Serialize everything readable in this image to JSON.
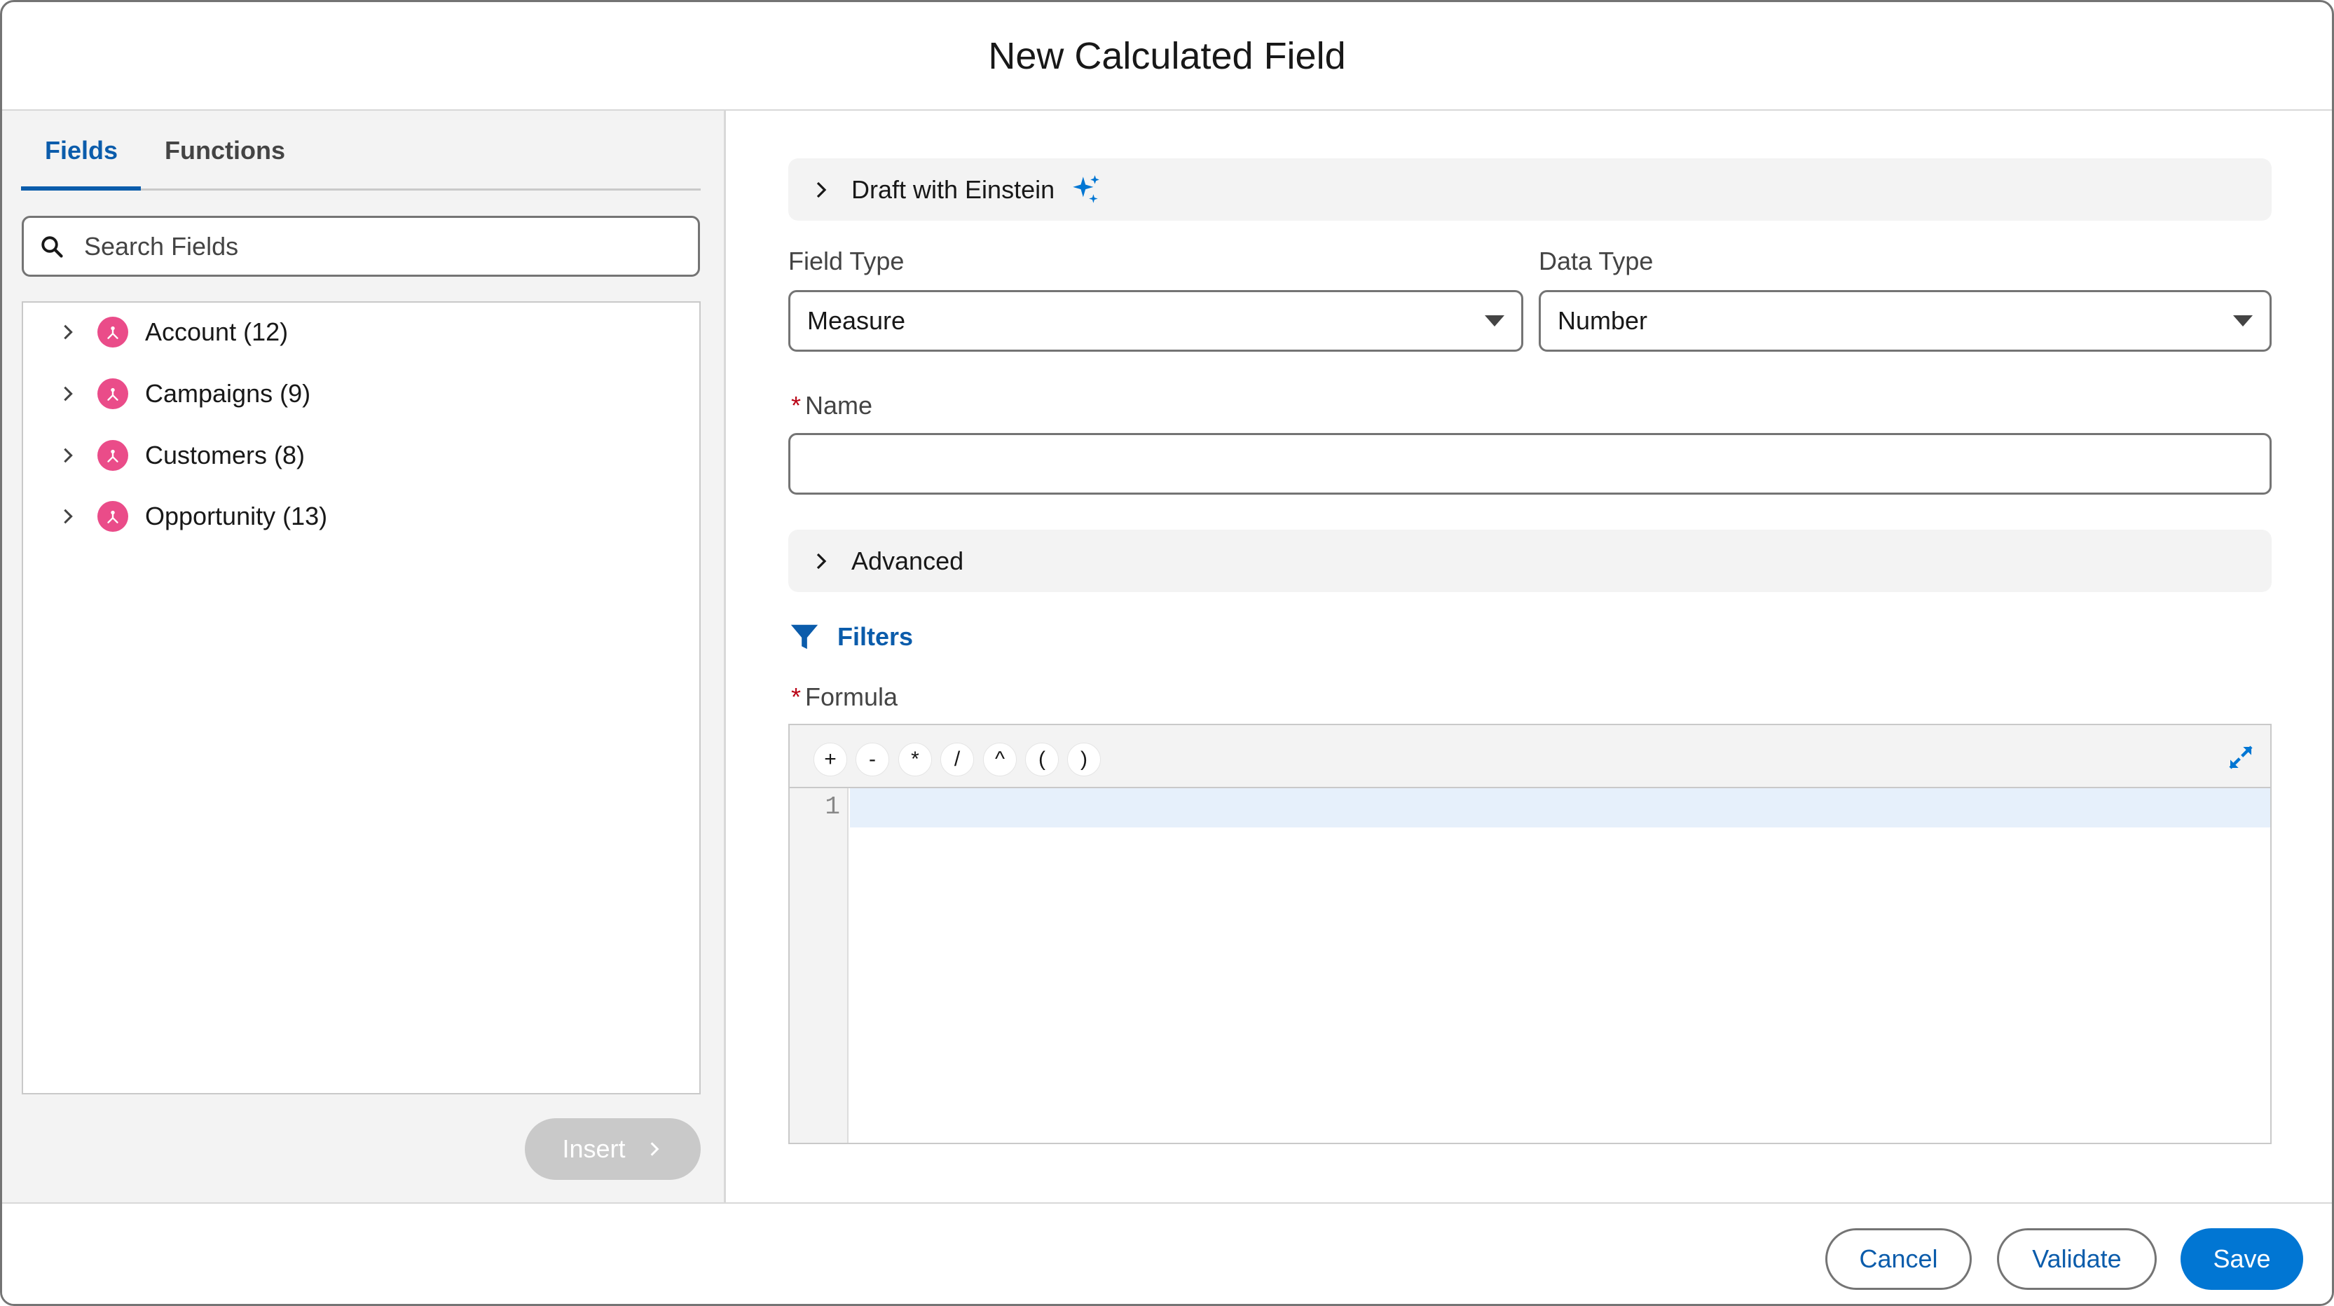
{
  "modal": {
    "title": "New Calculated Field"
  },
  "left_panel": {
    "tabs": [
      {
        "label": "Fields",
        "active": true
      },
      {
        "label": "Functions",
        "active": false
      }
    ],
    "search": {
      "placeholder": "Search Fields",
      "value": ""
    },
    "tree_items": [
      {
        "label": "Account (12)",
        "icon": "object-icon"
      },
      {
        "label": "Campaigns (9)",
        "icon": "object-icon"
      },
      {
        "label": "Customers (8)",
        "icon": "object-icon"
      },
      {
        "label": "Opportunity (13)",
        "icon": "object-icon"
      }
    ],
    "insert_label": "Insert"
  },
  "right_panel": {
    "einstein": {
      "label": "Draft with Einstein",
      "icon": "sparkles-icon"
    },
    "field_type": {
      "label": "Field Type",
      "value": "Measure"
    },
    "data_type": {
      "label": "Data Type",
      "value": "Number"
    },
    "name": {
      "label": "Name",
      "required_mark": "*",
      "value": ""
    },
    "advanced": {
      "label": "Advanced"
    },
    "filters": {
      "label": "Filters",
      "icon": "filter-icon"
    },
    "formula": {
      "label": "Formula",
      "required_mark": "*",
      "operators": [
        "+",
        "-",
        "*",
        "/",
        "^",
        "(",
        ")"
      ],
      "line_numbers": [
        "1"
      ]
    }
  },
  "footer": {
    "cancel_label": "Cancel",
    "validate_label": "Validate",
    "save_label": "Save"
  },
  "colors": {
    "brand": "#0176d3",
    "link": "#0b5cab",
    "object_icon": "#ea4c89",
    "required": "#ba0517",
    "einstein": "#0176d3"
  }
}
